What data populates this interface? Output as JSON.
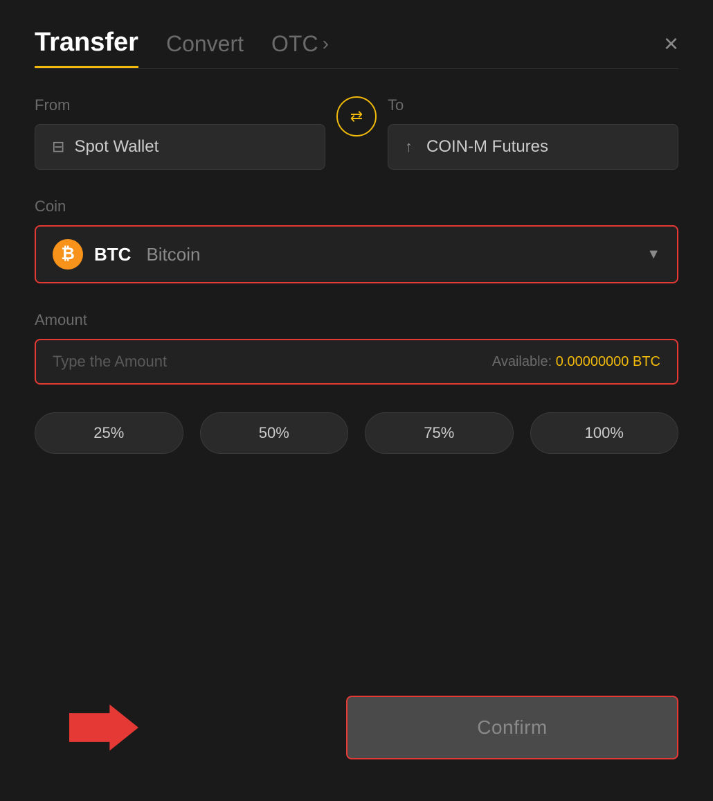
{
  "header": {
    "tab_transfer": "Transfer",
    "tab_convert": "Convert",
    "tab_otc": "OTC",
    "tab_otc_chevron": "›",
    "close_label": "×"
  },
  "from_section": {
    "label": "From",
    "wallet_name": "Spot Wallet"
  },
  "to_section": {
    "label": "To",
    "wallet_name": "COIN-M Futures"
  },
  "coin_section": {
    "label": "Coin",
    "coin_symbol": "BTC",
    "coin_name": "Bitcoin",
    "btc_symbol": "₿"
  },
  "amount_section": {
    "label": "Amount",
    "placeholder": "Type the Amount",
    "available_label": "Available:",
    "available_value": "0.00000000 BTC"
  },
  "pct_buttons": [
    {
      "label": "25%",
      "value": "25"
    },
    {
      "label": "50%",
      "value": "50"
    },
    {
      "label": "75%",
      "value": "75"
    },
    {
      "label": "100%",
      "value": "100"
    }
  ],
  "confirm_button": {
    "label": "Confirm"
  }
}
